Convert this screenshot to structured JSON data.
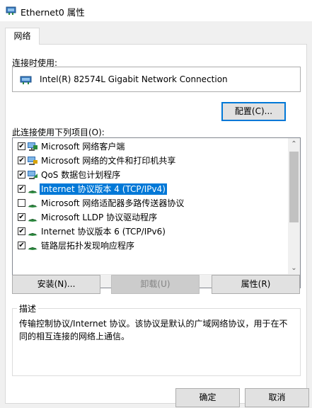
{
  "window": {
    "title": "Ethernet0 属性"
  },
  "tabs": [
    {
      "label": "网络"
    }
  ],
  "connect_using": {
    "label": "连接时使用:",
    "adapter_name": "Intel(R) 82574L Gigabit Network Connection"
  },
  "configure_button": "配置(C)...",
  "items_label": "此连接使用下列项目(O):",
  "items": [
    {
      "label": "Microsoft 网络客户端",
      "checked": true,
      "icon": "network-client-icon"
    },
    {
      "label": "Microsoft 网络的文件和打印机共享",
      "checked": true,
      "icon": "file-printer-sharing-icon"
    },
    {
      "label": "QoS 数据包计划程序",
      "checked": true,
      "icon": "qos-icon"
    },
    {
      "label": "Internet 协议版本 4 (TCP/IPv4)",
      "checked": true,
      "icon": "protocol-icon",
      "selected": true
    },
    {
      "label": "Microsoft 网络适配器多路传送器协议",
      "checked": false,
      "icon": "protocol-icon"
    },
    {
      "label": "Microsoft LLDP 协议驱动程序",
      "checked": true,
      "icon": "protocol-icon"
    },
    {
      "label": "Internet 协议版本 6 (TCP/IPv6)",
      "checked": true,
      "icon": "protocol-icon"
    },
    {
      "label": "链路层拓扑发现响应程序",
      "checked": true,
      "icon": "protocol-icon"
    }
  ],
  "buttons": {
    "install": "安装(N)...",
    "uninstall": "卸载(U)",
    "properties": "属性(R)",
    "ok": "确定",
    "cancel": "取消"
  },
  "description": {
    "title": "描述",
    "text": "传输控制协议/Internet 协议。该协议是默认的广域网络协议，用于在不同的相互连接的网络上通信。"
  },
  "colors": {
    "selection": "#0078d7",
    "dialog_bg": "#f0f0f0"
  }
}
